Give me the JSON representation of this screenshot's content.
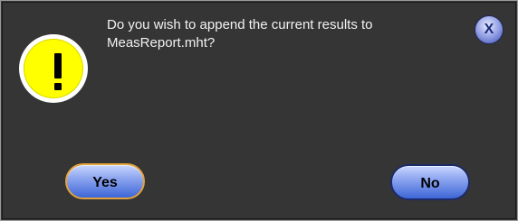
{
  "dialog": {
    "message": "Do you wish to append the current results to\nMeasReport.mht?",
    "icon": "warning-exclamation-icon",
    "close_label": "X",
    "buttons": {
      "yes_label": "Yes",
      "no_label": "No"
    }
  },
  "colors": {
    "background": "#353535",
    "text": "#f2f2f2",
    "warning_fill": "#ffff00",
    "button_fill": "#5a7ee0",
    "focus_border": "#e2a23c"
  }
}
